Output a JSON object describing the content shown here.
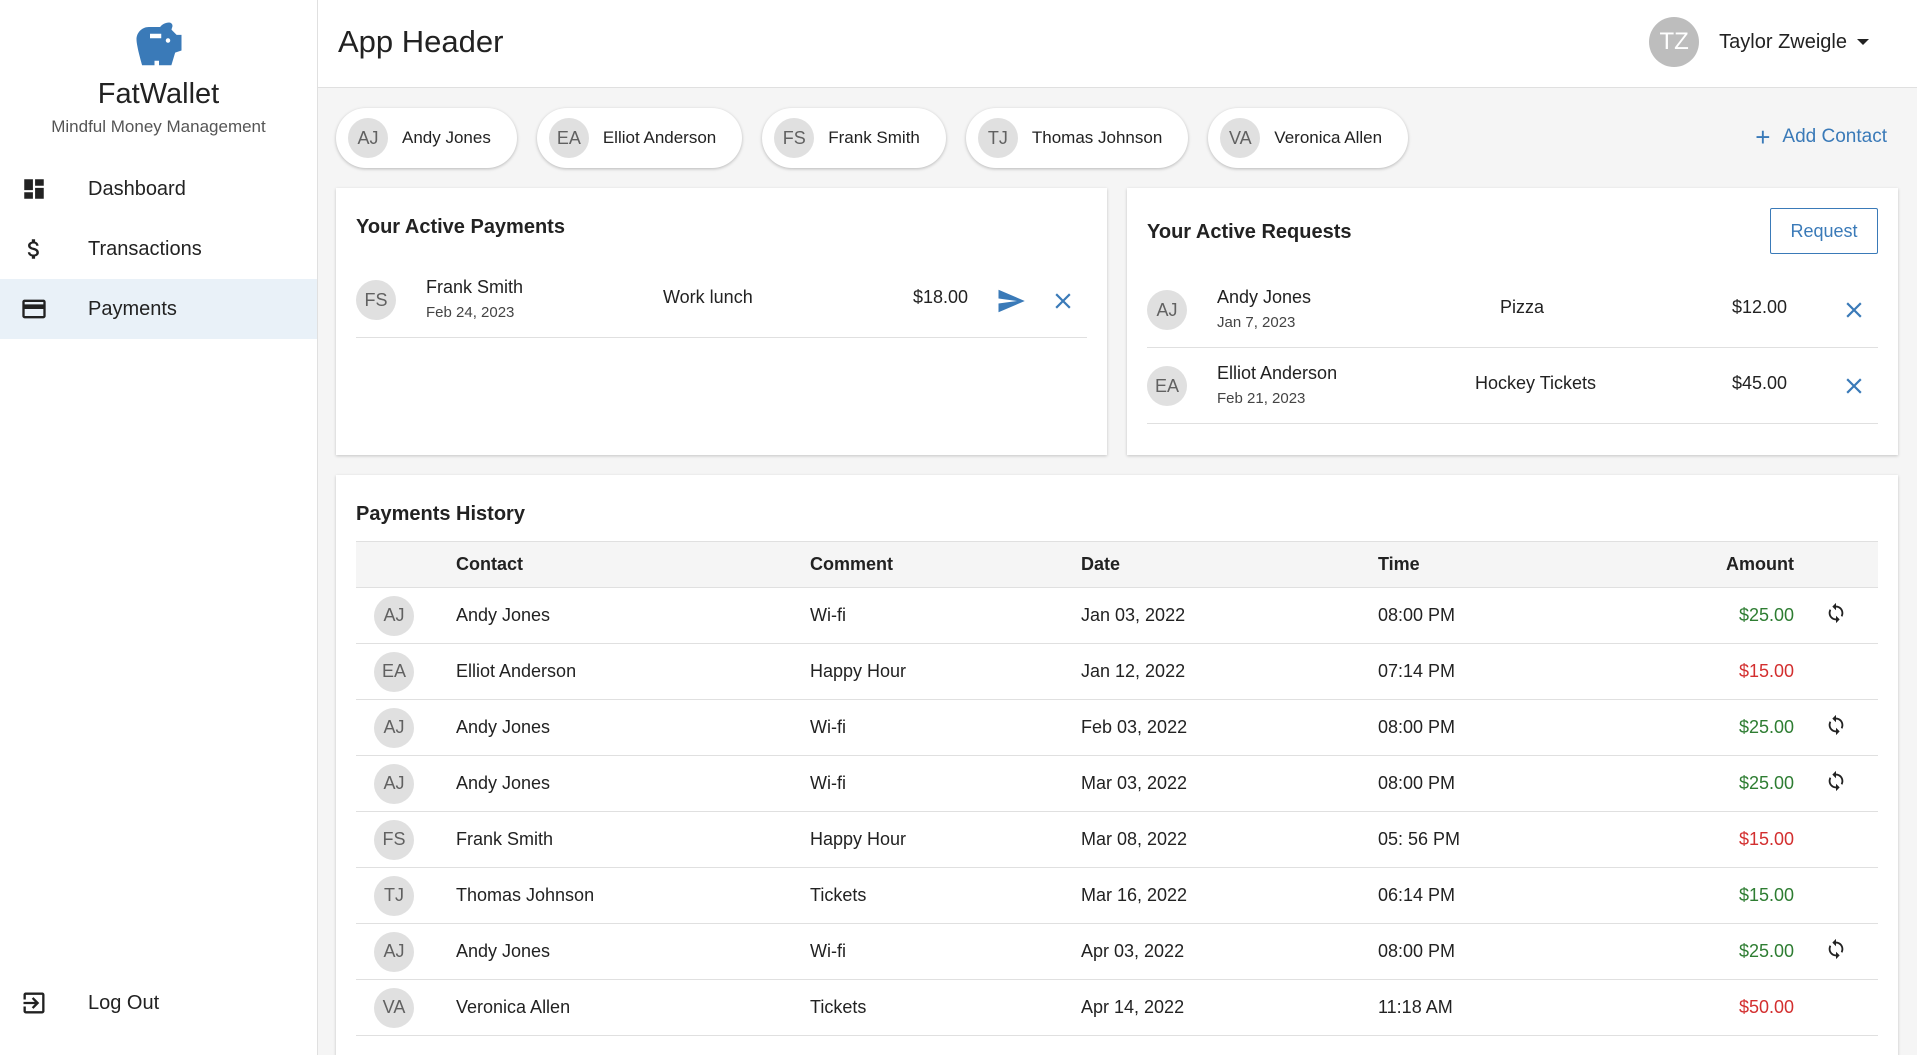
{
  "app": {
    "name": "FatWallet",
    "tagline": "Mindful Money Management",
    "brand_color": "#3a7ab8"
  },
  "sidebar": {
    "items": [
      {
        "label": "Dashboard",
        "icon": "dashboard-icon"
      },
      {
        "label": "Transactions",
        "icon": "dollar-icon"
      },
      {
        "label": "Payments",
        "icon": "credit-card-icon",
        "active": true
      }
    ],
    "logout_label": "Log Out"
  },
  "header": {
    "title": "App Header",
    "user_initials": "TZ",
    "user_name": "Taylor Zweigle"
  },
  "contacts": {
    "items": [
      {
        "initials": "AJ",
        "name": "Andy Jones"
      },
      {
        "initials": "EA",
        "name": "Elliot Anderson"
      },
      {
        "initials": "FS",
        "name": "Frank Smith"
      },
      {
        "initials": "TJ",
        "name": "Thomas Johnson"
      },
      {
        "initials": "VA",
        "name": "Veronica Allen"
      }
    ],
    "add_label": "Add Contact"
  },
  "active_payments": {
    "title": "Your Active Payments",
    "rows": [
      {
        "initials": "FS",
        "name": "Frank Smith",
        "date": "Feb 24, 2023",
        "comment": "Work lunch",
        "amount": "$18.00"
      }
    ]
  },
  "active_requests": {
    "title": "Your Active Requests",
    "request_label": "Request",
    "rows": [
      {
        "initials": "AJ",
        "name": "Andy Jones",
        "date": "Jan 7, 2023",
        "comment": "Pizza",
        "amount": "$12.00"
      },
      {
        "initials": "EA",
        "name": "Elliot Anderson",
        "date": "Feb 21, 2023",
        "comment": "Hockey Tickets",
        "amount": "$45.00"
      }
    ]
  },
  "history": {
    "title": "Payments History",
    "columns": [
      "Contact",
      "Comment",
      "Date",
      "Time",
      "Amount"
    ],
    "rows": [
      {
        "initials": "AJ",
        "contact": "Andy Jones",
        "comment": "Wi-fi",
        "date": "Jan 03, 2022",
        "time": "08:00 PM",
        "amount": "$25.00",
        "positive": true,
        "recurring": true
      },
      {
        "initials": "EA",
        "contact": "Elliot Anderson",
        "comment": "Happy Hour",
        "date": "Jan 12, 2022",
        "time": "07:14 PM",
        "amount": "$15.00",
        "positive": false,
        "recurring": false
      },
      {
        "initials": "AJ",
        "contact": "Andy Jones",
        "comment": "Wi-fi",
        "date": "Feb 03, 2022",
        "time": "08:00 PM",
        "amount": "$25.00",
        "positive": true,
        "recurring": true
      },
      {
        "initials": "AJ",
        "contact": "Andy Jones",
        "comment": "Wi-fi",
        "date": "Mar 03, 2022",
        "time": "08:00 PM",
        "amount": "$25.00",
        "positive": true,
        "recurring": true
      },
      {
        "initials": "FS",
        "contact": "Frank Smith",
        "comment": "Happy Hour",
        "date": "Mar 08, 2022",
        "time": "05: 56 PM",
        "amount": "$15.00",
        "positive": false,
        "recurring": false
      },
      {
        "initials": "TJ",
        "contact": "Thomas Johnson",
        "comment": "Tickets",
        "date": "Mar 16, 2022",
        "time": "06:14 PM",
        "amount": "$15.00",
        "positive": true,
        "recurring": false
      },
      {
        "initials": "AJ",
        "contact": "Andy Jones",
        "comment": "Wi-fi",
        "date": "Apr 03, 2022",
        "time": "08:00 PM",
        "amount": "$25.00",
        "positive": true,
        "recurring": true
      },
      {
        "initials": "VA",
        "contact": "Veronica Allen",
        "comment": "Tickets",
        "date": "Apr 14, 2022",
        "time": "11:18 AM",
        "amount": "$50.00",
        "positive": false,
        "recurring": false
      }
    ]
  },
  "colors": {
    "positive": "#2e7d32",
    "negative": "#d32f2f",
    "accent": "#3a7ab8"
  }
}
